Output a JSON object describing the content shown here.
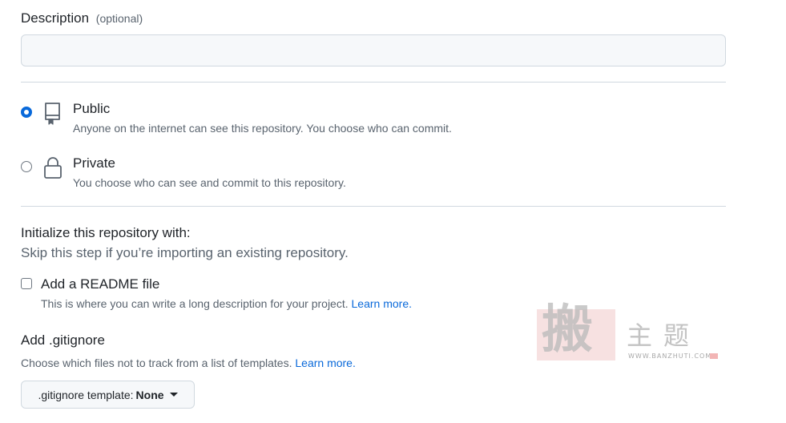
{
  "description": {
    "label": "Description",
    "optional": "(optional)",
    "value": "",
    "placeholder": ""
  },
  "visibility": {
    "options": [
      {
        "title": "Public",
        "description": "Anyone on the internet can see this repository. You choose who can commit.",
        "icon": "repo-icon",
        "checked": true
      },
      {
        "title": "Private",
        "description": "You choose who can see and commit to this repository.",
        "icon": "lock-icon",
        "checked": false
      }
    ]
  },
  "initialize": {
    "title": "Initialize this repository with:",
    "subtitle": "Skip this step if you’re importing an existing repository."
  },
  "readme": {
    "label": "Add a README file",
    "description": "This is where you can write a long description for your project.",
    "link": "Learn more.",
    "checked": false
  },
  "gitignore": {
    "title": "Add .gitignore",
    "description": "Choose which files not to track from a list of templates.",
    "link": "Learn more.",
    "button_label": ".gitignore template:",
    "button_value": "None"
  },
  "watermark": {
    "glyph": "搬",
    "text": "主题",
    "url": "WWW.BANZHUTI.COM"
  },
  "colors": {
    "accent": "#0969da",
    "border": "#d1d9e0",
    "muted_text": "#59636e",
    "input_bg": "#f6f8fa"
  }
}
